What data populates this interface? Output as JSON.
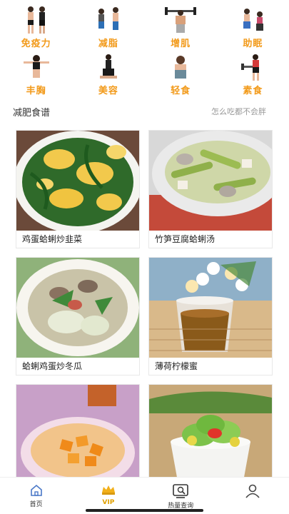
{
  "categories": [
    {
      "label": "免疫力",
      "icon": "immunity-figure-icon"
    },
    {
      "label": "减脂",
      "icon": "fat-loss-figure-icon"
    },
    {
      "label": "增肌",
      "icon": "muscle-gain-figure-icon"
    },
    {
      "label": "助眠",
      "icon": "sleep-aid-figure-icon"
    },
    {
      "label": "丰胸",
      "icon": "bust-figure-icon"
    },
    {
      "label": "美容",
      "icon": "beauty-figure-icon"
    },
    {
      "label": "轻食",
      "icon": "light-meal-figure-icon"
    },
    {
      "label": "素食",
      "icon": "vegetarian-figure-icon"
    }
  ],
  "section": {
    "title": "减肥食谱",
    "subtitle": "怎么吃都不会胖"
  },
  "recipes": [
    {
      "name": "鸡蛋蛤蜊炒韭菜"
    },
    {
      "name": "竹笋豆腐蛤蜊汤"
    },
    {
      "name": "蛤蜊鸡蛋炒冬瓜"
    },
    {
      "name": "薄荷柠檬蜜"
    },
    {
      "name": ""
    },
    {
      "name": ""
    }
  ],
  "tabbar": [
    {
      "label": "首页",
      "icon": "home-icon"
    },
    {
      "label": "VIP",
      "icon": "crown-icon"
    },
    {
      "label": "热量查询",
      "icon": "calorie-search-icon"
    },
    {
      "label": "",
      "icon": "profile-icon"
    }
  ],
  "colors": {
    "accent": "#f29a1a",
    "vip": "#e0a000"
  }
}
